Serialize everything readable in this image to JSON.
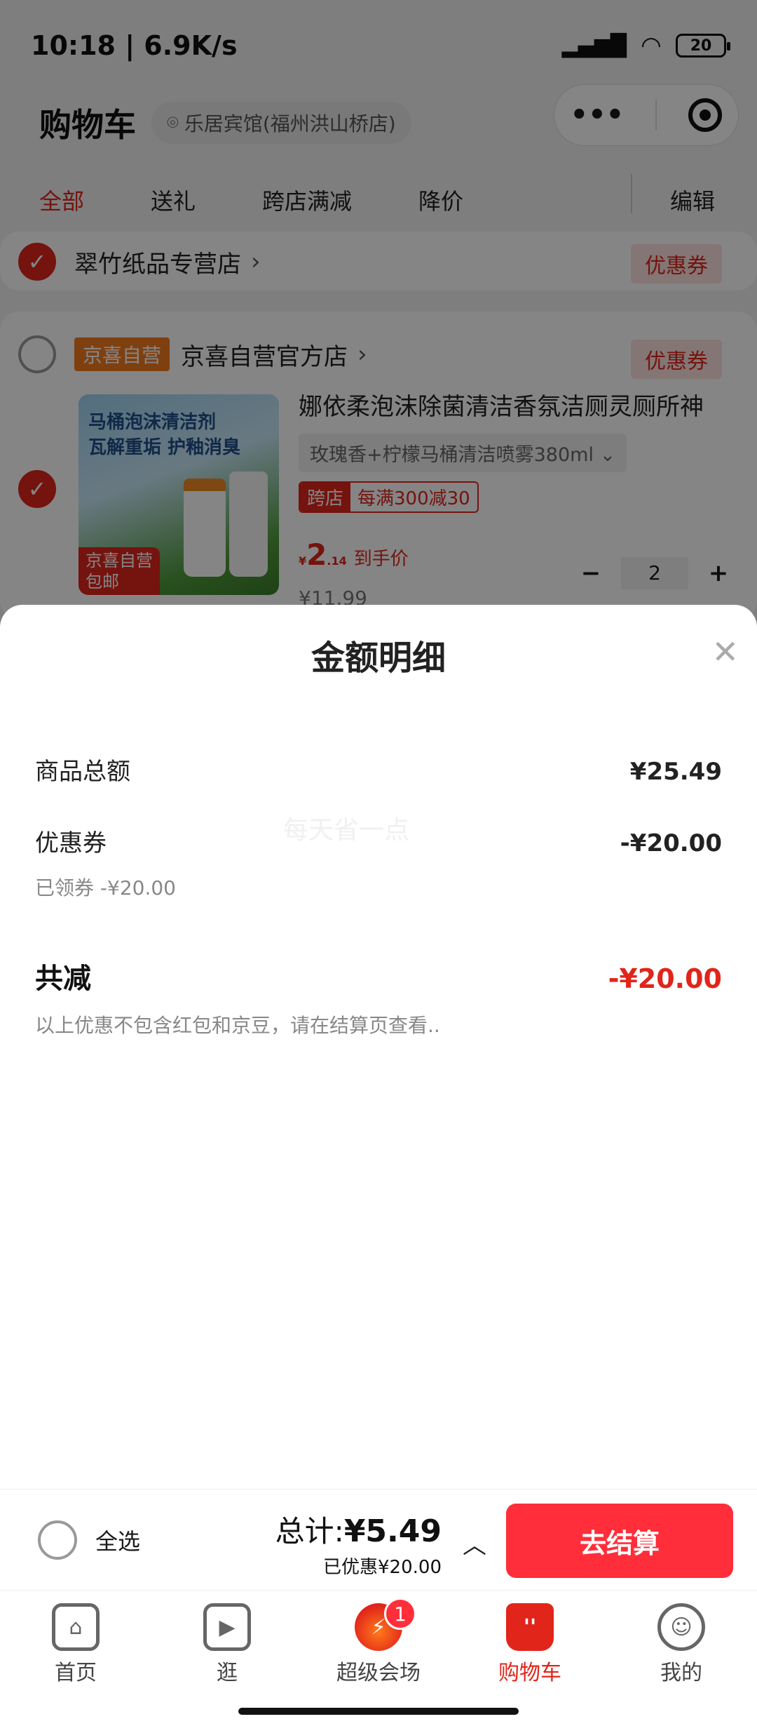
{
  "status": {
    "time": "10:18 | 6.9K/s",
    "battery": "20"
  },
  "header": {
    "title": "购物车",
    "location": "乐居宾馆(福州洪山桥店)"
  },
  "filters": {
    "tabs": [
      "全部",
      "送礼",
      "跨店满减",
      "降价"
    ],
    "edit": "编辑"
  },
  "shops": [
    {
      "name": "翠竹纸品专营店",
      "coupon": "优惠券",
      "checked": true
    },
    {
      "tag": "京喜自营",
      "name": "京喜自营官方店",
      "coupon": "优惠券",
      "checked": false
    }
  ],
  "product": {
    "title": "娜依柔泡沫除菌清洁香氛洁厕灵厕所神",
    "spec": "玫瑰香+柠檬马桶清洁喷雾380ml",
    "promo_tag": "跨店",
    "promo_text": "每满300减30",
    "price_symbol": "¥",
    "price_int": "2",
    "price_dec": ".14",
    "price_unit": "到手价",
    "old_price": "¥11.99",
    "qty": "2",
    "image_text": "马桶泡沫清洁剂\n瓦解重垢 护釉消臭",
    "image_badge": "京喜自营\n包邮"
  },
  "sheet": {
    "title": "金额明细",
    "watermark": "每天省一点",
    "items_total_label": "商品总额",
    "items_total_value": "¥25.49",
    "coupon_label": "优惠券",
    "coupon_value": "-¥20.00",
    "coupon_note": "已领券 -¥20.00",
    "discount_label": "共减",
    "discount_value": "-¥20.00",
    "footnote": "以上优惠不包含红包和京豆，请在结算页查看.."
  },
  "checkout": {
    "select_all": "全选",
    "total_prefix": "总计:",
    "total_value": "¥5.49",
    "saved_prefix": "已优惠",
    "saved_value": "¥20.00",
    "button": "去结算"
  },
  "tabbar": [
    {
      "label": "首页",
      "icon": "home-icon"
    },
    {
      "label": "逛",
      "icon": "video-icon"
    },
    {
      "label": "超级会场",
      "icon": "flame-icon",
      "badge": "1"
    },
    {
      "label": "购物车",
      "icon": "cart-icon"
    },
    {
      "label": "我的",
      "icon": "smile-icon"
    }
  ]
}
